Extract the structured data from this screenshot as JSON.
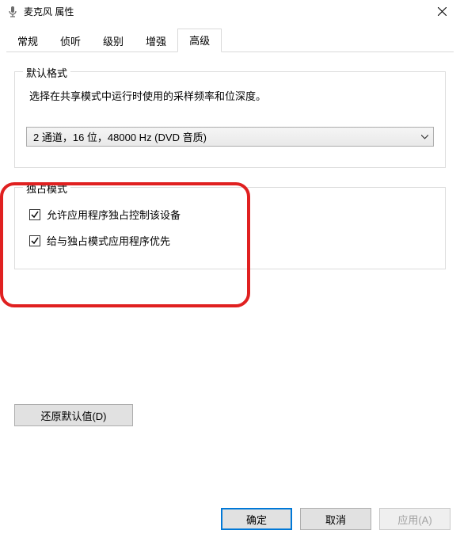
{
  "window": {
    "title": "麦克风 属性",
    "close_label": "关闭"
  },
  "tabs": {
    "items": [
      {
        "label": "常规"
      },
      {
        "label": "侦听"
      },
      {
        "label": "级别"
      },
      {
        "label": "增强"
      },
      {
        "label": "高级"
      }
    ],
    "active_index": 4
  },
  "group_default": {
    "legend": "默认格式",
    "description": "选择在共享模式中运行时使用的采样频率和位深度。",
    "dropdown_value": "2 通道，16 位，48000 Hz (DVD 音质)"
  },
  "group_exclusive": {
    "legend": "独占模式",
    "check1_label": "允许应用程序独占控制该设备",
    "check1_checked": true,
    "check2_label": "给与独占模式应用程序优先",
    "check2_checked": true
  },
  "buttons": {
    "restore": "还原默认值(D)",
    "ok": "确定",
    "cancel": "取消",
    "apply": "应用(A)"
  }
}
